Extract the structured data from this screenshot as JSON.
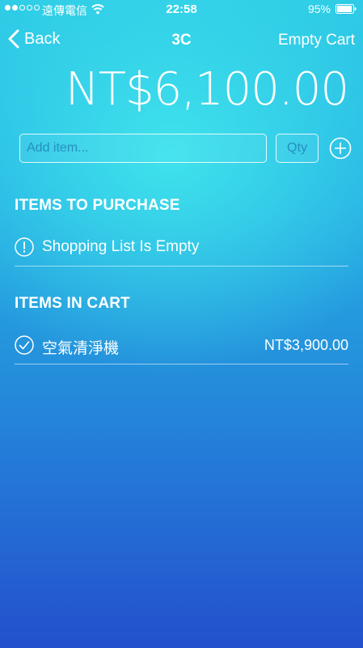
{
  "status_bar": {
    "carrier": "遠傳電信",
    "time": "22:58",
    "battery_percent": "95%",
    "battery_level": 0.95,
    "signal_filled": 2,
    "signal_total": 5
  },
  "nav": {
    "back_label": "Back",
    "title": "3C",
    "empty_cart_label": "Empty Cart"
  },
  "total": "NT$6,100.00",
  "add_form": {
    "item_placeholder": "Add item...",
    "qty_placeholder": "Qty"
  },
  "sections": {
    "purchase": {
      "header": "ITEMS TO PURCHASE",
      "empty_message": "Shopping List Is Empty"
    },
    "cart": {
      "header": "ITEMS IN CART",
      "items": [
        {
          "name": "空氣清淨機",
          "price": "NT$3,900.00"
        }
      ]
    }
  },
  "icons": {
    "back": "chevron-left-icon",
    "add": "plus-circle-icon",
    "empty": "exclamation-circle-icon",
    "checked": "checkmark-circle-icon",
    "wifi": "wifi-icon",
    "battery": "battery-icon"
  },
  "colors": {
    "text": "#ffffff",
    "placeholder": "#1e78b4",
    "gradient_top": "#2ecbe6",
    "gradient_bottom": "#2350cc"
  }
}
